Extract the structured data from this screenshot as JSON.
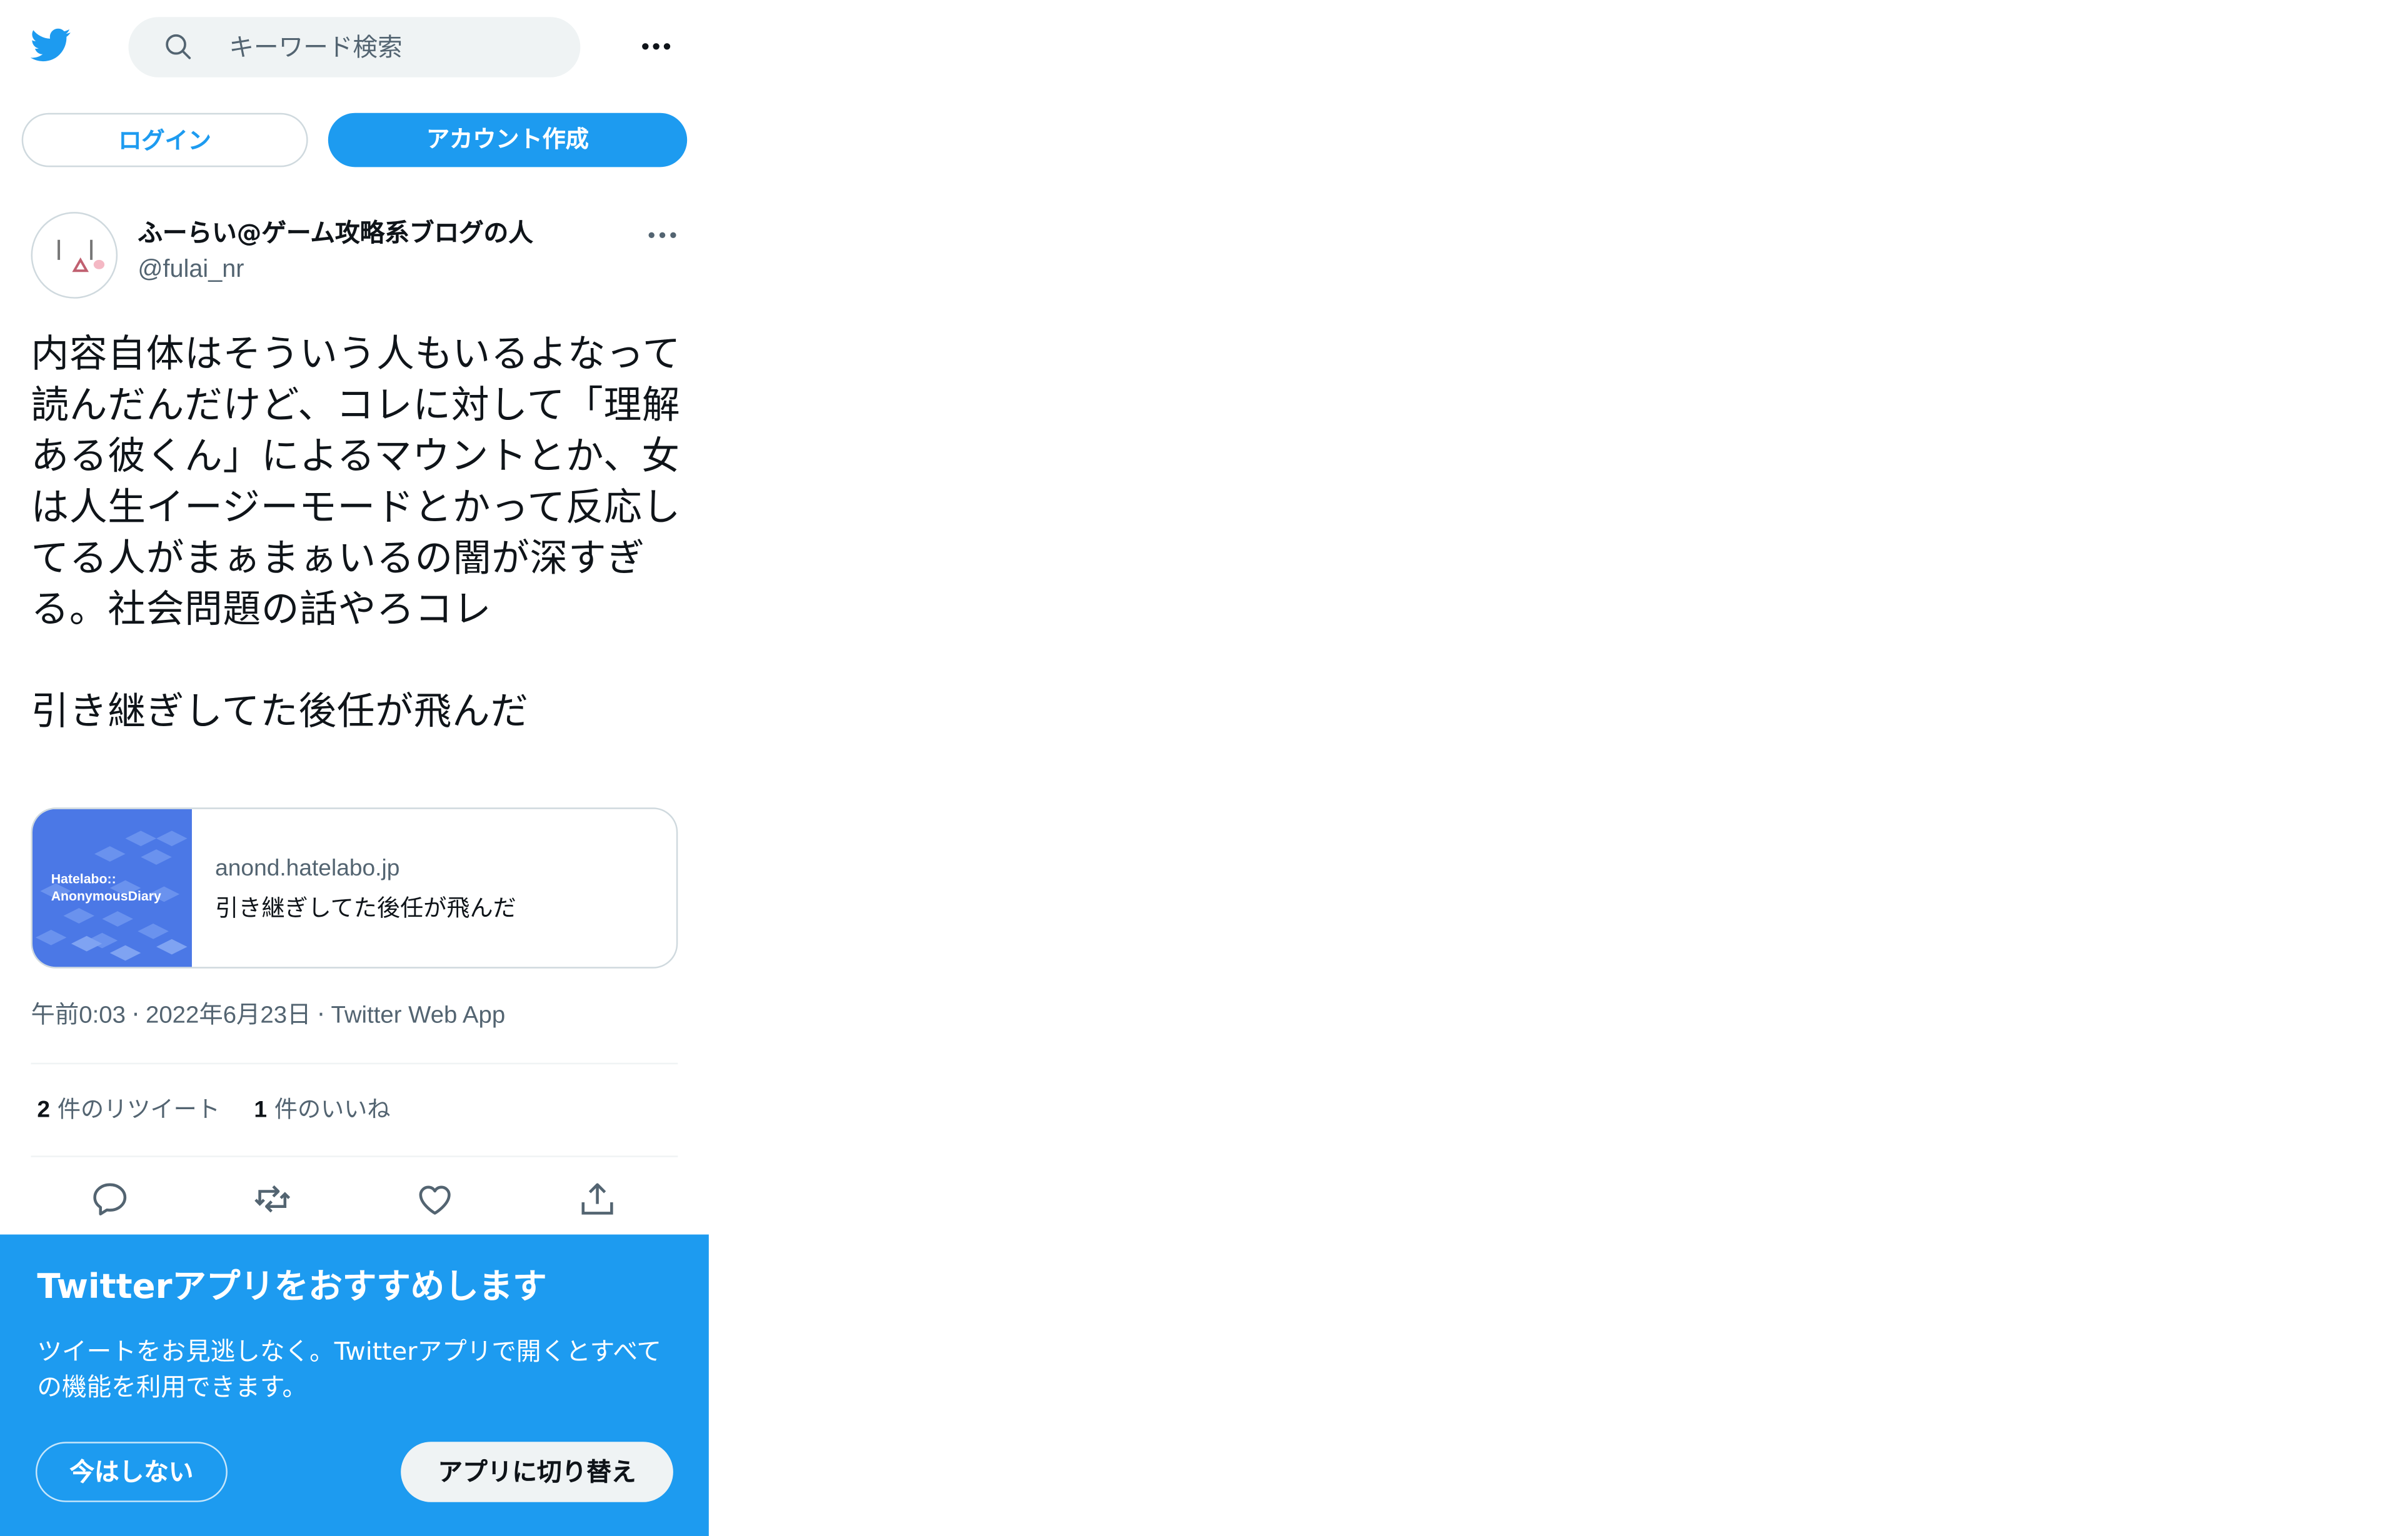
{
  "header": {
    "logo_icon": "twitter-bird-icon",
    "search_placeholder": "キーワード検索",
    "more_icon": "more-horizontal-icon"
  },
  "auth": {
    "login_label": "ログイン",
    "signup_label": "アカウント作成"
  },
  "tweet": {
    "display_name": "ふーらい@ゲーム攻略系ブログの人",
    "handle": "@fulai_nr",
    "text": "内容自体はそういう人もいるよなって読んだんだけど、コレに対して「理解ある彼くん」によるマウントとか、女は人生イージーモードとかって反応してる人がまぁまぁいるの闇が深すぎる。社会問題の話やろコレ\n\n引き継ぎしてた後任が飛んだ",
    "card": {
      "brand_text": "Hatelabo::\nAnonymousDiary",
      "domain": "anond.hatelabo.jp",
      "title": "引き継ぎしてた後任が飛んだ"
    },
    "time": "午前0:03",
    "date": "2022年6月23日",
    "source": "Twitter Web App",
    "retweet_count": "2",
    "retweet_label": "件のリツイート",
    "like_count": "1",
    "like_label": "件のいいね",
    "actions": [
      "reply-icon",
      "retweet-icon",
      "like-icon",
      "share-icon"
    ]
  },
  "banner": {
    "title": "Twitterアプリをおすすめします",
    "body": "ツイートをお見逃しなく。Twitterアプリで開くとすべての機能を利用できます。",
    "dismiss_label": "今はしない",
    "switch_label": "アプリに切り替え"
  },
  "colors": {
    "brand_blue": "#1d9bf0",
    "text_secondary": "#536471",
    "border": "#cfd9de"
  }
}
